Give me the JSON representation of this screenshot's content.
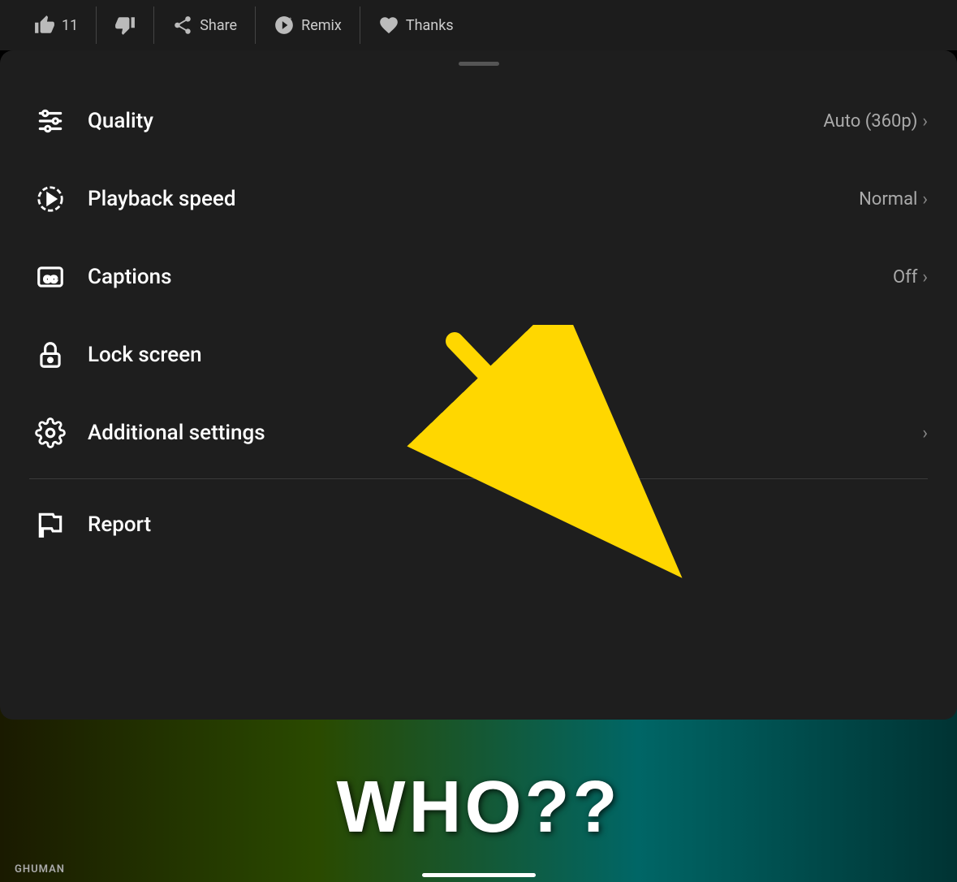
{
  "topBar": {
    "actions": [
      {
        "id": "like",
        "icon": "thumbs-up",
        "label": "Like",
        "count": "11"
      },
      {
        "id": "dislike",
        "icon": "thumbs-down",
        "label": "Dislike",
        "count": ""
      },
      {
        "id": "share",
        "icon": "share",
        "label": "Share",
        "count": ""
      },
      {
        "id": "remix",
        "icon": "remix",
        "label": "Remix",
        "count": ""
      },
      {
        "id": "thanks",
        "icon": "thanks",
        "label": "Thanks",
        "count": ""
      }
    ]
  },
  "menu": {
    "items": [
      {
        "id": "quality",
        "icon": "sliders",
        "label": "Quality",
        "value": "Auto (360p)",
        "hasChevron": true
      },
      {
        "id": "playback-speed",
        "icon": "playback",
        "label": "Playback speed",
        "value": "Normal",
        "hasChevron": true
      },
      {
        "id": "captions",
        "icon": "captions",
        "label": "Captions",
        "value": "Off",
        "hasChevron": true
      },
      {
        "id": "lock-screen",
        "icon": "lock",
        "label": "Lock screen",
        "value": "",
        "hasChevron": false
      },
      {
        "id": "additional-settings",
        "icon": "settings",
        "label": "Additional settings",
        "value": "",
        "hasChevron": true
      }
    ],
    "bottomItems": [
      {
        "id": "report",
        "icon": "flag",
        "label": "Report",
        "value": "",
        "hasChevron": false
      }
    ]
  },
  "videoBg": {
    "text": "WHO??",
    "label": "GHUMAN"
  }
}
